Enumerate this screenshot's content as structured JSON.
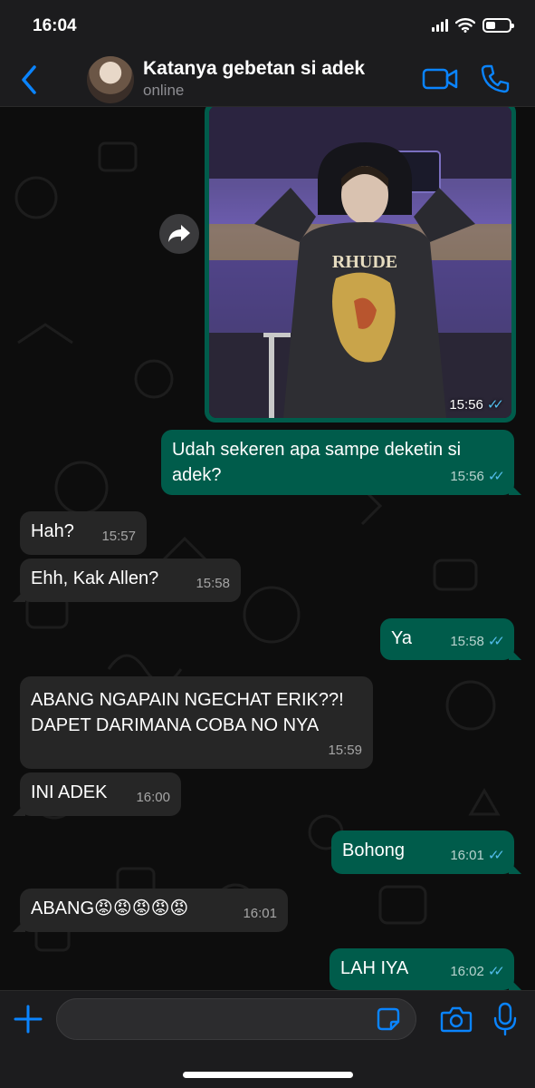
{
  "status_bar": {
    "time": "16:04"
  },
  "header": {
    "contact_name": "Katanya gebetan si adek",
    "contact_status": "online"
  },
  "photo_message": {
    "time": "15:56"
  },
  "messages": [
    {
      "text": "Udah sekeren apa sampe deketin si adek?",
      "time": "15:56",
      "direction": "outgoing"
    },
    {
      "text": "Hah?",
      "time": "15:57",
      "direction": "incoming"
    },
    {
      "text": "Ehh, Kak Allen?",
      "time": "15:58",
      "direction": "incoming"
    },
    {
      "text": "Ya",
      "time": "15:58",
      "direction": "outgoing"
    },
    {
      "text": "ABANG NGAPAIN NGECHAT ERIK??! DAPET DARIMANA COBA NO NYA",
      "time": "15:59",
      "direction": "incoming"
    },
    {
      "text": "INI ADEK",
      "time": "16:00",
      "direction": "incoming"
    },
    {
      "text": "Bohong",
      "time": "16:01",
      "direction": "outgoing"
    },
    {
      "text": "ABANG😡😡😡😡😡",
      "time": "16:01",
      "direction": "incoming"
    },
    {
      "text": "LAH IYA",
      "time": "16:02",
      "direction": "outgoing"
    }
  ],
  "composer": {
    "placeholder": ""
  },
  "colors": {
    "accent": "#0a84ff",
    "outgoing_bubble": "#005c4b",
    "incoming_bubble": "#262626",
    "read_tick": "#53bdeb"
  }
}
